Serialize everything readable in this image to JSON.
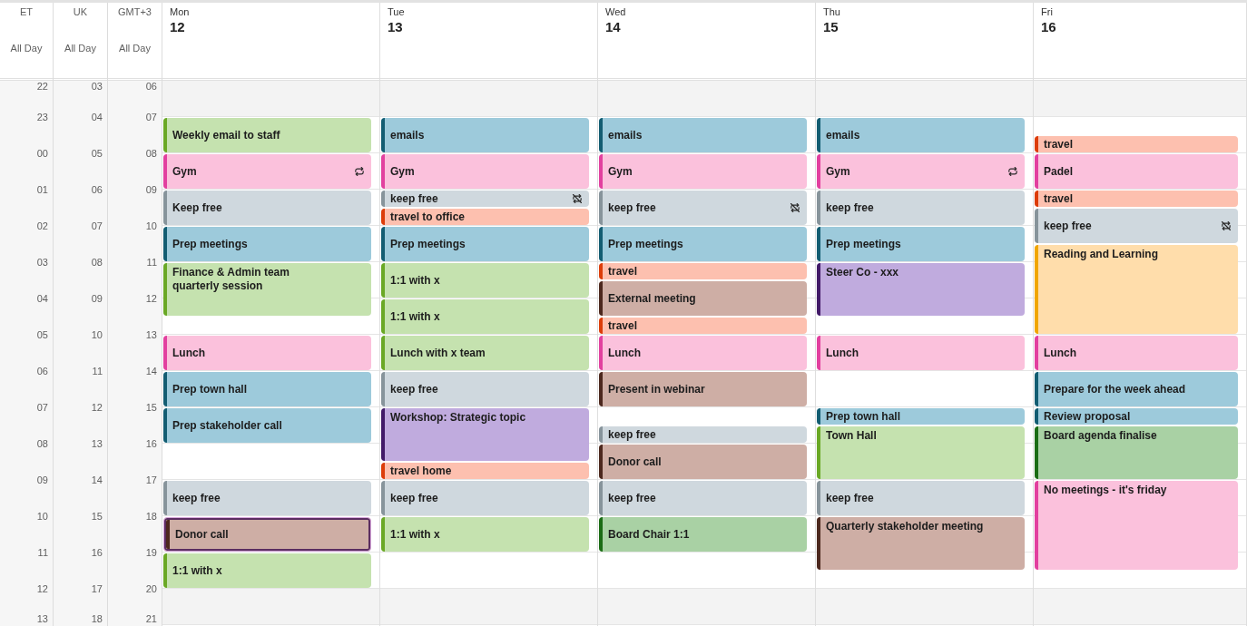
{
  "time_zones": [
    {
      "label": "ET",
      "all_day_label": "All Day",
      "hours": [
        "22",
        "23",
        "00",
        "01",
        "02",
        "03",
        "04",
        "05",
        "06",
        "07",
        "08",
        "09",
        "10",
        "11",
        "12",
        "13"
      ]
    },
    {
      "label": "UK",
      "all_day_label": "All Day",
      "hours": [
        "03",
        "04",
        "05",
        "06",
        "07",
        "08",
        "09",
        "10",
        "11",
        "12",
        "13",
        "14",
        "15",
        "16",
        "17",
        "18"
      ]
    },
    {
      "label": "GMT+3",
      "all_day_label": "All Day",
      "hours": [
        "06",
        "07",
        "08",
        "09",
        "10",
        "11",
        "12",
        "13",
        "14",
        "15",
        "16",
        "17",
        "18",
        "19",
        "20",
        "21"
      ]
    }
  ],
  "days": [
    {
      "name": "Mon",
      "date": "12",
      "hours": [
        {
          "kind": "off"
        },
        {
          "kind": "work",
          "events": [
            {
              "title": "Weekly email to staff",
              "kind": "hour",
              "half_past": false,
              "color": "#6aa825",
              "recurring": false,
              "exception": false,
              "selected": false
            }
          ]
        },
        {
          "kind": "work",
          "events": [
            {
              "title": "Gym",
              "kind": "hour",
              "half_past": false,
              "color": "#e2409f",
              "recurring": true,
              "exception": false,
              "selected": false
            }
          ]
        },
        {
          "kind": "work",
          "events": [
            {
              "title": "Keep free",
              "kind": "hour",
              "half_past": false,
              "color": "#87949b",
              "recurring": false,
              "exception": false,
              "selected": false
            }
          ]
        },
        {
          "kind": "work",
          "events": [
            {
              "title": "Prep meetings",
              "kind": "hour",
              "half_past": false,
              "color": "#135d72",
              "recurring": false,
              "exception": false,
              "selected": false
            }
          ]
        },
        {
          "kind": "work",
          "events": [
            {
              "title": "Finance & Admin team quarterly session",
              "kind": "long",
              "half_past": false,
              "color": "#6aa825",
              "recurring": false,
              "exception": false,
              "selected": false
            }
          ]
        },
        {
          "kind": "work"
        },
        {
          "kind": "work",
          "events": [
            {
              "title": "Lunch",
              "kind": "hour",
              "half_past": false,
              "color": "#e2409f",
              "recurring": false,
              "exception": false,
              "selected": false
            }
          ]
        },
        {
          "kind": "work",
          "events": [
            {
              "title": "Prep town hall",
              "kind": "hour",
              "half_past": false,
              "color": "#135d72",
              "recurring": false,
              "exception": false,
              "selected": false
            }
          ]
        },
        {
          "kind": "work",
          "events": [
            {
              "title": "Prep stakeholder call",
              "kind": "hour",
              "half_past": false,
              "color": "#135d72",
              "recurring": false,
              "exception": false,
              "selected": false
            }
          ]
        },
        {
          "kind": "work"
        },
        {
          "kind": "work",
          "events": [
            {
              "title": "keep free",
              "kind": "hour",
              "half_past": false,
              "color": "#87949b",
              "recurring": false,
              "exception": false,
              "selected": false
            }
          ]
        },
        {
          "kind": "work",
          "events": [
            {
              "title": "Donor call",
              "kind": "hour",
              "half_past": false,
              "color": "#4c281e",
              "recurring": false,
              "exception": false,
              "selected": true
            }
          ]
        },
        {
          "kind": "work",
          "events": [
            {
              "title": "1:1 with x",
              "kind": "hour",
              "half_past": false,
              "color": "#6aa825",
              "recurring": false,
              "exception": false,
              "selected": false
            }
          ]
        },
        {
          "kind": "off"
        }
      ]
    },
    {
      "name": "Tue",
      "date": "13",
      "hours": [
        {
          "kind": "off"
        },
        {
          "kind": "work",
          "events": [
            {
              "title": "emails",
              "kind": "hour",
              "half_past": false,
              "color": "#135d72",
              "recurring": false,
              "exception": false,
              "selected": false
            }
          ]
        },
        {
          "kind": "work",
          "events": [
            {
              "title": "Gym",
              "kind": "hour",
              "half_past": false,
              "color": "#e2409f",
              "recurring": false,
              "exception": false,
              "selected": false
            }
          ]
        },
        {
          "kind": "work",
          "events": [
            {
              "title": "keep free",
              "kind": "half",
              "half_past": false,
              "color": "#87949b",
              "recurring": false,
              "exception": true,
              "selected": false
            },
            {
              "title": "travel to office",
              "kind": "half",
              "half_past": true,
              "color": "#dc3d0a",
              "recurring": false,
              "exception": false,
              "selected": false
            }
          ]
        },
        {
          "kind": "work",
          "events": [
            {
              "title": "Prep meetings",
              "kind": "hour",
              "half_past": false,
              "color": "#135d72",
              "recurring": false,
              "exception": false,
              "selected": false
            }
          ]
        },
        {
          "kind": "work",
          "events": [
            {
              "title": "1:1 with x",
              "kind": "hour",
              "half_past": false,
              "color": "#6aa825",
              "recurring": false,
              "exception": false,
              "selected": false
            }
          ]
        },
        {
          "kind": "work",
          "events": [
            {
              "title": "1:1 with x",
              "kind": "hour",
              "half_past": false,
              "color": "#6aa825",
              "recurring": false,
              "exception": false,
              "selected": false
            }
          ]
        },
        {
          "kind": "work",
          "events": [
            {
              "title": "Lunch with x team",
              "kind": "hour",
              "half_past": false,
              "color": "#6aa825",
              "recurring": false,
              "exception": false,
              "selected": false
            }
          ]
        },
        {
          "kind": "work",
          "events": [
            {
              "title": "keep free",
              "kind": "hour",
              "half_past": false,
              "color": "#87949b",
              "recurring": false,
              "exception": false,
              "selected": false
            }
          ]
        },
        {
          "kind": "work",
          "events": [
            {
              "title": "Workshop: Strategic topic",
              "kind": "long",
              "half_past": false,
              "color": "#421a68",
              "recurring": false,
              "exception": false,
              "selected": false
            }
          ]
        },
        {
          "kind": "work",
          "events": [
            {
              "title": "travel home",
              "kind": "half",
              "half_past": true,
              "color": "#dc3d0a",
              "recurring": false,
              "exception": false,
              "selected": false
            }
          ]
        },
        {
          "kind": "work",
          "events": [
            {
              "title": "keep free",
              "kind": "hour",
              "half_past": false,
              "color": "#87949b",
              "recurring": false,
              "exception": false,
              "selected": false
            }
          ]
        },
        {
          "kind": "work",
          "events": [
            {
              "title": "1:1 with x",
              "kind": "hour",
              "half_past": false,
              "color": "#6aa825",
              "recurring": false,
              "exception": false,
              "selected": false
            }
          ]
        },
        {
          "kind": "work"
        },
        {
          "kind": "off"
        }
      ]
    },
    {
      "name": "Wed",
      "date": "14",
      "hours": [
        {
          "kind": "off"
        },
        {
          "kind": "work",
          "events": [
            {
              "title": "emails",
              "kind": "hour",
              "half_past": false,
              "color": "#135d72",
              "recurring": false,
              "exception": false,
              "selected": false
            }
          ]
        },
        {
          "kind": "work",
          "events": [
            {
              "title": "Gym",
              "kind": "hour",
              "half_past": false,
              "color": "#e2409f",
              "recurring": false,
              "exception": false,
              "selected": false
            }
          ]
        },
        {
          "kind": "work",
          "events": [
            {
              "title": "keep free",
              "kind": "hour",
              "half_past": false,
              "color": "#87949b",
              "recurring": false,
              "exception": true,
              "selected": false
            }
          ]
        },
        {
          "kind": "work",
          "events": [
            {
              "title": "Prep meetings",
              "kind": "hour",
              "half_past": false,
              "color": "#135d72",
              "recurring": false,
              "exception": false,
              "selected": false
            }
          ]
        },
        {
          "kind": "work",
          "events": [
            {
              "title": "travel",
              "kind": "half",
              "half_past": false,
              "color": "#dc3d0a",
              "recurring": false,
              "exception": false,
              "selected": false
            },
            {
              "title": "External meeting",
              "kind": "hour",
              "half_past": true,
              "color": "#4c281e",
              "recurring": false,
              "exception": false,
              "selected": false
            }
          ]
        },
        {
          "kind": "work",
          "events": [
            {
              "title": "travel",
              "kind": "half",
              "half_past": true,
              "color": "#dc3d0a",
              "recurring": false,
              "exception": false,
              "selected": false
            }
          ]
        },
        {
          "kind": "work",
          "events": [
            {
              "title": "Lunch",
              "kind": "hour",
              "half_past": false,
              "color": "#e2409f",
              "recurring": false,
              "exception": false,
              "selected": false
            }
          ]
        },
        {
          "kind": "work",
          "events": [
            {
              "title": "Present in webinar",
              "kind": "hour",
              "half_past": false,
              "color": "#4c281e",
              "recurring": false,
              "exception": false,
              "selected": false
            }
          ]
        },
        {
          "kind": "work",
          "events": [
            {
              "title": "keep free",
              "kind": "half",
              "half_past": true,
              "color": "#87949b",
              "recurring": false,
              "exception": false,
              "selected": false
            }
          ]
        },
        {
          "kind": "work",
          "events": [
            {
              "title": "Donor call",
              "kind": "hour",
              "half_past": false,
              "color": "#4c281e",
              "recurring": false,
              "exception": false,
              "selected": false
            }
          ]
        },
        {
          "kind": "work",
          "events": [
            {
              "title": "keep free",
              "kind": "hour",
              "half_past": false,
              "color": "#87949b",
              "recurring": false,
              "exception": false,
              "selected": false
            }
          ]
        },
        {
          "kind": "work",
          "events": [
            {
              "title": "Board Chair 1:1",
              "kind": "hour",
              "half_past": false,
              "color": "#1b6c15",
              "recurring": false,
              "exception": false,
              "selected": false
            }
          ]
        },
        {
          "kind": "work"
        },
        {
          "kind": "off"
        }
      ]
    },
    {
      "name": "Thu",
      "date": "15",
      "hours": [
        {
          "kind": "off"
        },
        {
          "kind": "work",
          "events": [
            {
              "title": "emails",
              "kind": "hour",
              "half_past": false,
              "color": "#135d72",
              "recurring": false,
              "exception": false,
              "selected": false
            }
          ]
        },
        {
          "kind": "work",
          "events": [
            {
              "title": "Gym",
              "kind": "hour",
              "half_past": false,
              "color": "#e2409f",
              "recurring": true,
              "exception": false,
              "selected": false
            }
          ]
        },
        {
          "kind": "work",
          "events": [
            {
              "title": "keep free",
              "kind": "hour",
              "half_past": false,
              "color": "#87949b",
              "recurring": false,
              "exception": false,
              "selected": false
            }
          ]
        },
        {
          "kind": "work",
          "events": [
            {
              "title": "Prep meetings",
              "kind": "hour",
              "half_past": false,
              "color": "#135d72",
              "recurring": false,
              "exception": false,
              "selected": false
            }
          ]
        },
        {
          "kind": "work",
          "events": [
            {
              "title": "Steer Co - xxx",
              "kind": "long",
              "half_past": false,
              "color": "#421a68",
              "recurring": false,
              "exception": false,
              "selected": false
            }
          ]
        },
        {
          "kind": "work"
        },
        {
          "kind": "work",
          "events": [
            {
              "title": "Lunch",
              "kind": "hour",
              "half_past": false,
              "color": "#e2409f",
              "recurring": false,
              "exception": false,
              "selected": false
            }
          ]
        },
        {
          "kind": "work"
        },
        {
          "kind": "work",
          "events": [
            {
              "title": "Prep town hall",
              "kind": "half",
              "half_past": false,
              "color": "#135d72",
              "recurring": false,
              "exception": false,
              "selected": false
            },
            {
              "title": "Town Hall",
              "kind": "long",
              "half_past": true,
              "color": "#6aa825",
              "recurring": false,
              "exception": false,
              "selected": false
            }
          ]
        },
        {
          "kind": "work"
        },
        {
          "kind": "work",
          "events": [
            {
              "title": "keep free",
              "kind": "hour",
              "half_past": false,
              "color": "#87949b",
              "recurring": false,
              "exception": false,
              "selected": false
            }
          ]
        },
        {
          "kind": "work",
          "events": [
            {
              "title": "Quarterly stakeholder meeting",
              "kind": "long",
              "half_past": false,
              "color": "#4c281e",
              "recurring": false,
              "exception": false,
              "selected": false
            }
          ]
        },
        {
          "kind": "work"
        },
        {
          "kind": "off"
        }
      ]
    },
    {
      "name": "Fri",
      "date": "16",
      "hours": [
        {
          "kind": "off"
        },
        {
          "kind": "work",
          "events": [
            {
              "title": "travel",
              "kind": "half",
              "half_past": true,
              "color": "#dc3d0a",
              "recurring": false,
              "exception": false,
              "selected": false
            }
          ]
        },
        {
          "kind": "work",
          "events": [
            {
              "title": "Padel",
              "kind": "hour",
              "half_past": false,
              "color": "#e2409f",
              "recurring": false,
              "exception": false,
              "selected": false
            }
          ]
        },
        {
          "kind": "work",
          "events": [
            {
              "title": "travel",
              "kind": "half",
              "half_past": false,
              "color": "#dc3d0a",
              "recurring": false,
              "exception": false,
              "selected": false
            },
            {
              "title": "keep free",
              "kind": "hour",
              "half_past": true,
              "color": "#87949b",
              "recurring": false,
              "exception": true,
              "selected": false
            }
          ]
        },
        {
          "kind": "work",
          "events": [
            {
              "title": "Reading and Learning",
              "kind": "extended",
              "half_past": true,
              "color": "#f0a600",
              "recurring": false,
              "exception": false,
              "selected": false
            }
          ]
        },
        {
          "kind": "work"
        },
        {
          "kind": "work"
        },
        {
          "kind": "work",
          "events": [
            {
              "title": "Lunch",
              "kind": "hour",
              "half_past": false,
              "color": "#e2409f",
              "recurring": false,
              "exception": false,
              "selected": false
            }
          ]
        },
        {
          "kind": "work",
          "events": [
            {
              "title": "Prepare for the week ahead",
              "kind": "hour",
              "half_past": false,
              "color": "#135d72",
              "recurring": false,
              "exception": false,
              "selected": false
            }
          ]
        },
        {
          "kind": "work",
          "events": [
            {
              "title": "Review proposal",
              "kind": "half",
              "half_past": false,
              "color": "#135d72",
              "recurring": false,
              "exception": false,
              "selected": false
            },
            {
              "title": "Board agenda finalise",
              "kind": "long",
              "half_past": true,
              "color": "#1b6c15",
              "recurring": false,
              "exception": false,
              "selected": false
            }
          ]
        },
        {
          "kind": "work"
        },
        {
          "kind": "work",
          "events": [
            {
              "title": "No meetings - it's friday",
              "kind": "extended",
              "half_past": false,
              "color": "#e2409f",
              "recurring": false,
              "exception": false,
              "selected": false
            }
          ]
        },
        {
          "kind": "work"
        },
        {
          "kind": "work"
        },
        {
          "kind": "off"
        }
      ]
    }
  ]
}
